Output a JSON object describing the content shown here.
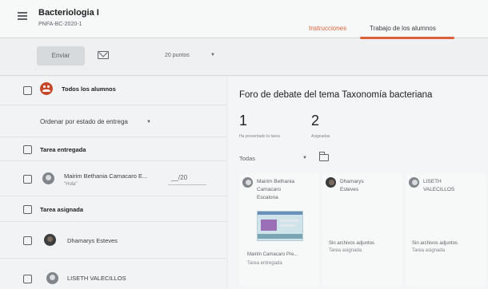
{
  "header": {
    "course_title": "Bacteriologia I",
    "course_code": "PNFA-BC-2020-1",
    "tabs": [
      {
        "label": "Instrucciones",
        "active": false
      },
      {
        "label": "Trabajo de los alumnos",
        "active": true
      }
    ],
    "accent_color": "#d9623b"
  },
  "toolbar": {
    "send_label": "Enviar",
    "mail_icon": "mail-icon",
    "points_value": "20 puntos"
  },
  "left_panel": {
    "all_students_label": "Todos los alumnos",
    "sort_label": "Ordenar por estado de entrega",
    "sections": [
      {
        "label": "Tarea entregada",
        "students": [
          {
            "name": "Mairim Bethania Camacaro E...",
            "note": "\"Hola\"",
            "grade": "__/20"
          }
        ]
      },
      {
        "label": "Tarea asignada",
        "students": [
          {
            "name": "Dhamarys Esteves"
          },
          {
            "name": "LISETH VALECILLOS"
          }
        ]
      }
    ]
  },
  "right_panel": {
    "assignment_title": "Foro de debate del tema Taxonomía bacteriana",
    "stats": [
      {
        "value": "1",
        "label": "Ha presentado la tarea"
      },
      {
        "value": "2",
        "label": "Asignadas"
      }
    ],
    "filter_value": "Todas",
    "cards": [
      {
        "name_lines": [
          "Mairim Bethania",
          "Camacaro",
          "Escalona"
        ],
        "attachment": "Mairim Camacaro Pre...",
        "status": "Tarea entregada"
      },
      {
        "name_lines": [
          "Dhamarys",
          "Esteves"
        ],
        "attachment": "Sin archivos adjuntos",
        "status": "Tarea asignada"
      },
      {
        "name_lines": [
          "LISETH",
          "VALECILLOS"
        ],
        "attachment": "Sin archivos adjuntos",
        "status": "Tarea asignada"
      }
    ]
  }
}
